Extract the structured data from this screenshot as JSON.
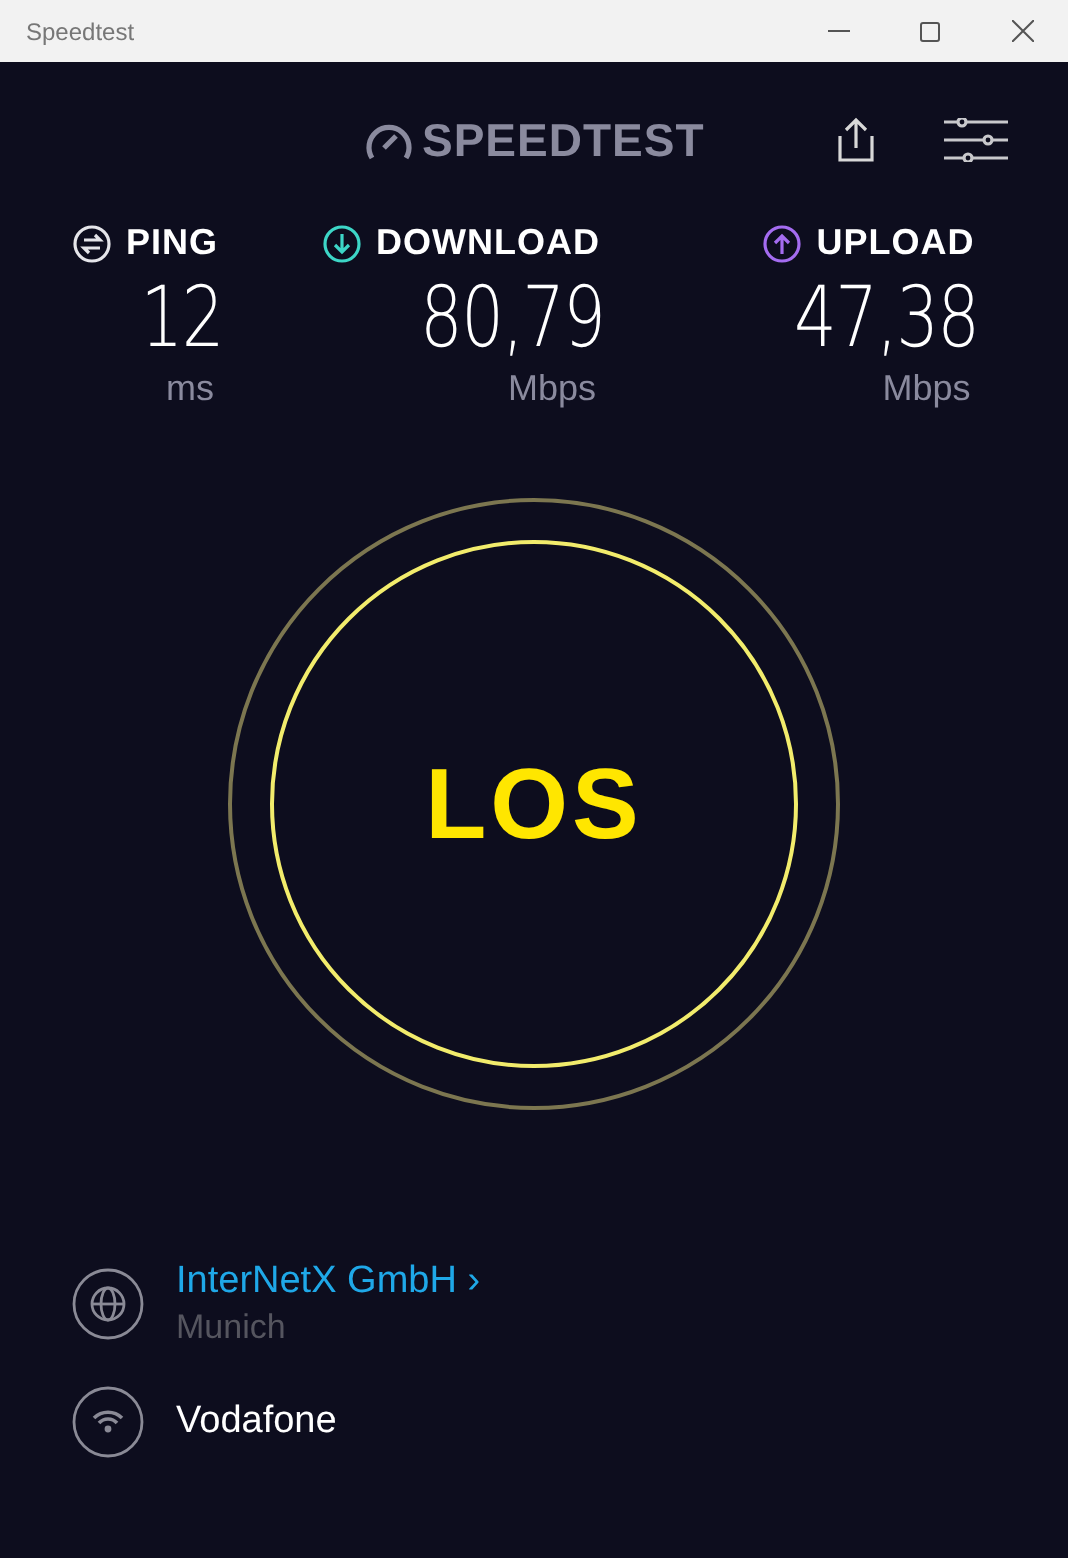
{
  "window": {
    "title": "Speedtest"
  },
  "logo": {
    "text": "SPEEDTEST"
  },
  "metrics": [
    {
      "kind": "ping",
      "label": "PING",
      "value": "12",
      "unit": "ms"
    },
    {
      "kind": "download",
      "label": "DOWNLOAD",
      "value": "80,79",
      "unit": "Mbps"
    },
    {
      "kind": "upload",
      "label": "UPLOAD",
      "value": "47,38",
      "unit": "Mbps"
    }
  ],
  "go_button": {
    "label": "LOS"
  },
  "server": {
    "name": "InterNetX GmbH",
    "chevron": "›",
    "location": "Munich"
  },
  "provider": {
    "name": "Vodafone"
  }
}
